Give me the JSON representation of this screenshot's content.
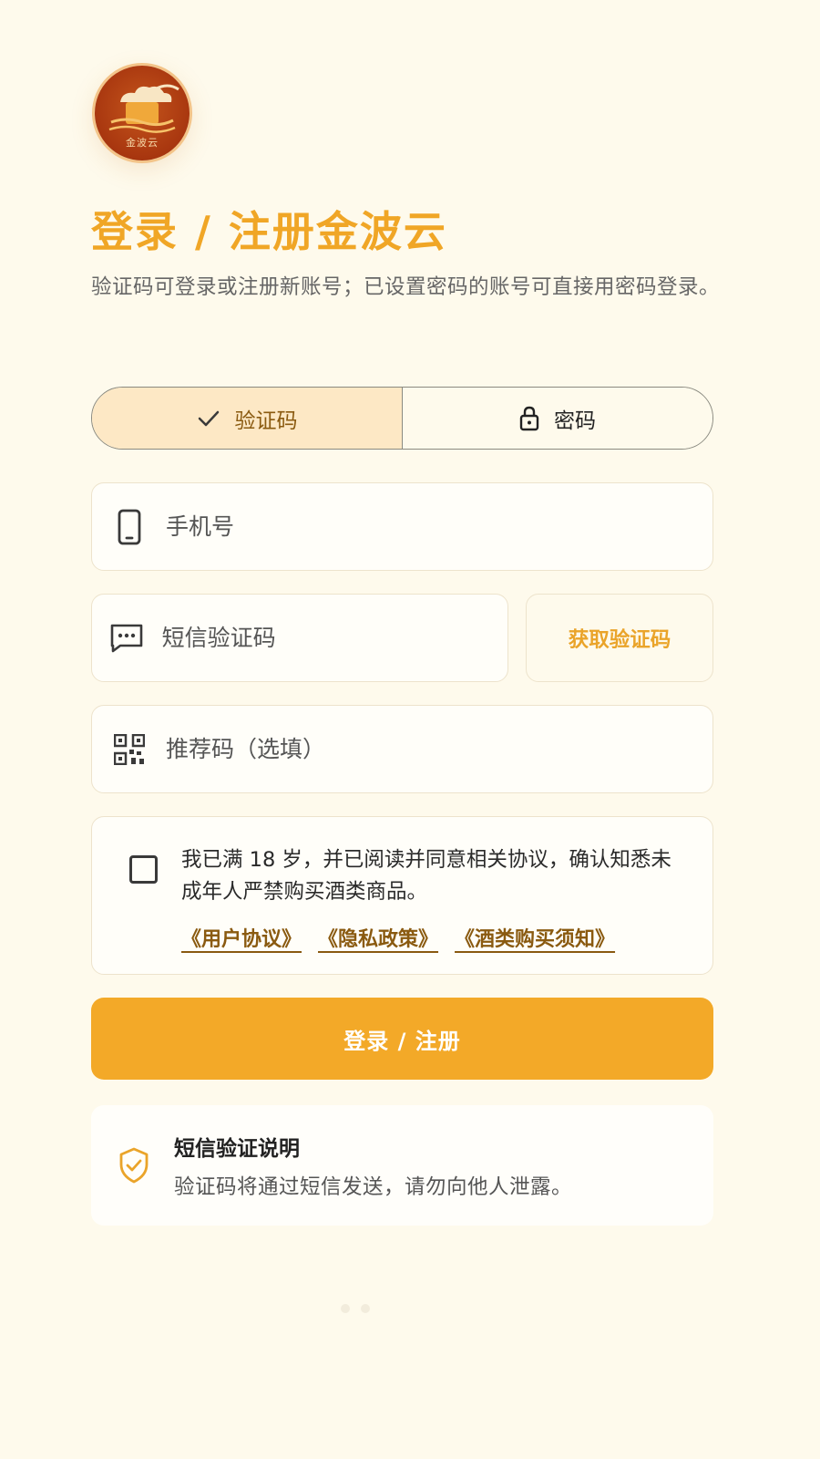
{
  "logo": {
    "text": "金波云"
  },
  "title": "登录 / 注册金波云",
  "subtitle": "验证码可登录或注册新账号；已设置密码的账号可直接用密码登录。",
  "tabs": [
    {
      "label": "验证码",
      "icon": "check-icon",
      "active": true
    },
    {
      "label": "密码",
      "icon": "lock-icon",
      "active": false
    }
  ],
  "phone": {
    "placeholder": "手机号",
    "icon": "phone-icon"
  },
  "sms_code": {
    "placeholder": "短信验证码",
    "icon": "message-icon",
    "get_code_label": "获取验证码"
  },
  "referral": {
    "placeholder": "推荐码（选填）",
    "icon": "qr-code-icon"
  },
  "agreement": {
    "text": "我已满 18 岁，并已阅读并同意相关协议，确认知悉未成年人严禁购买酒类商品。",
    "links": [
      "《用户协议》",
      "《隐私政策》",
      "《酒类购买须知》"
    ]
  },
  "submit_label": "登录 / 注册",
  "notice": {
    "title": "短信验证说明",
    "body": "验证码将通过短信发送，请勿向他人泄露。",
    "icon": "shield-check-icon"
  },
  "colors": {
    "accent": "#f3a928",
    "title": "#f0a626",
    "link": "#8a5a10",
    "background": "#fefaec"
  }
}
